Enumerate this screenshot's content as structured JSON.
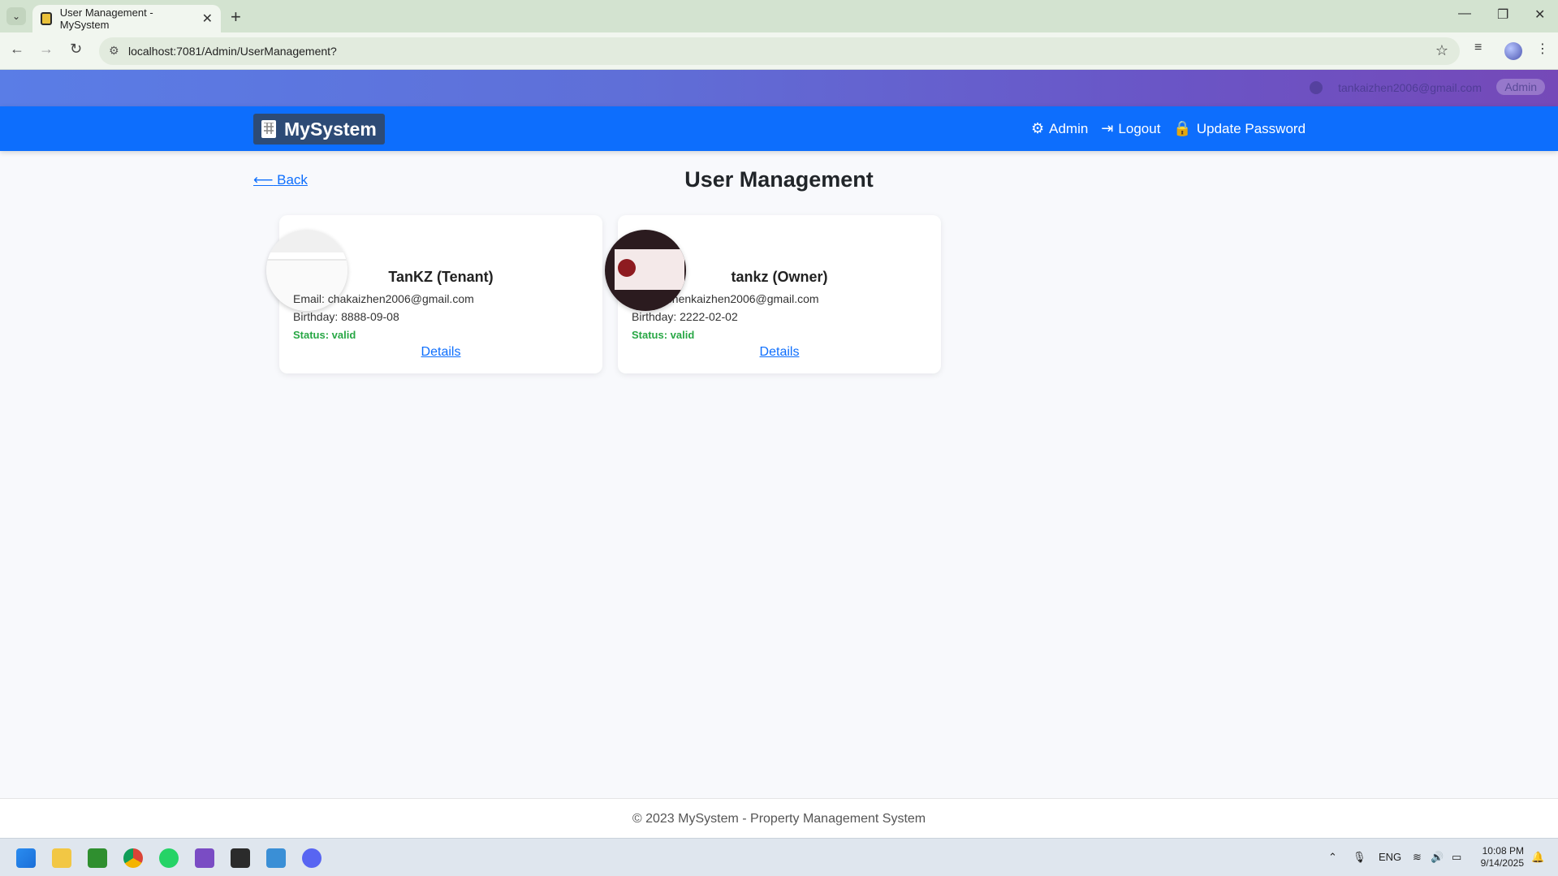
{
  "browser": {
    "tab_title": "User Management - MySystem",
    "url": "localhost:7081/Admin/UserManagement?"
  },
  "topstrip": {
    "user_email": "tankaizhen2006@gmail.com",
    "role_badge": "Admin"
  },
  "navbar": {
    "brand": "MySystem",
    "links": [
      {
        "label": "Admin",
        "icon": "gear-icon"
      },
      {
        "label": "Logout",
        "icon": "logout-icon"
      },
      {
        "label": "Update Password",
        "icon": "lock-icon"
      }
    ]
  },
  "page": {
    "back_label": "Back",
    "title": "User Management"
  },
  "users": [
    {
      "name": "TanKZ (Tenant)",
      "email": "Email: chakaizhen2006@gmail.com",
      "birthday": "Birthday: 8888-09-08",
      "status": "Status: valid",
      "details_label": "Details"
    },
    {
      "name": "tankz (Owner)",
      "email": "Email: chenkaizhen2006@gmail.com",
      "birthday": "Birthday: 2222-02-02",
      "status": "Status: valid",
      "details_label": "Details"
    }
  ],
  "footer": {
    "text": "© 2023 MySystem - Property Management System"
  },
  "taskbar": {
    "lang": "ENG",
    "time": "10:08 PM",
    "date": "9/14/2025"
  },
  "colors": {
    "primary": "#0d6efd",
    "status_valid": "#28a745"
  }
}
